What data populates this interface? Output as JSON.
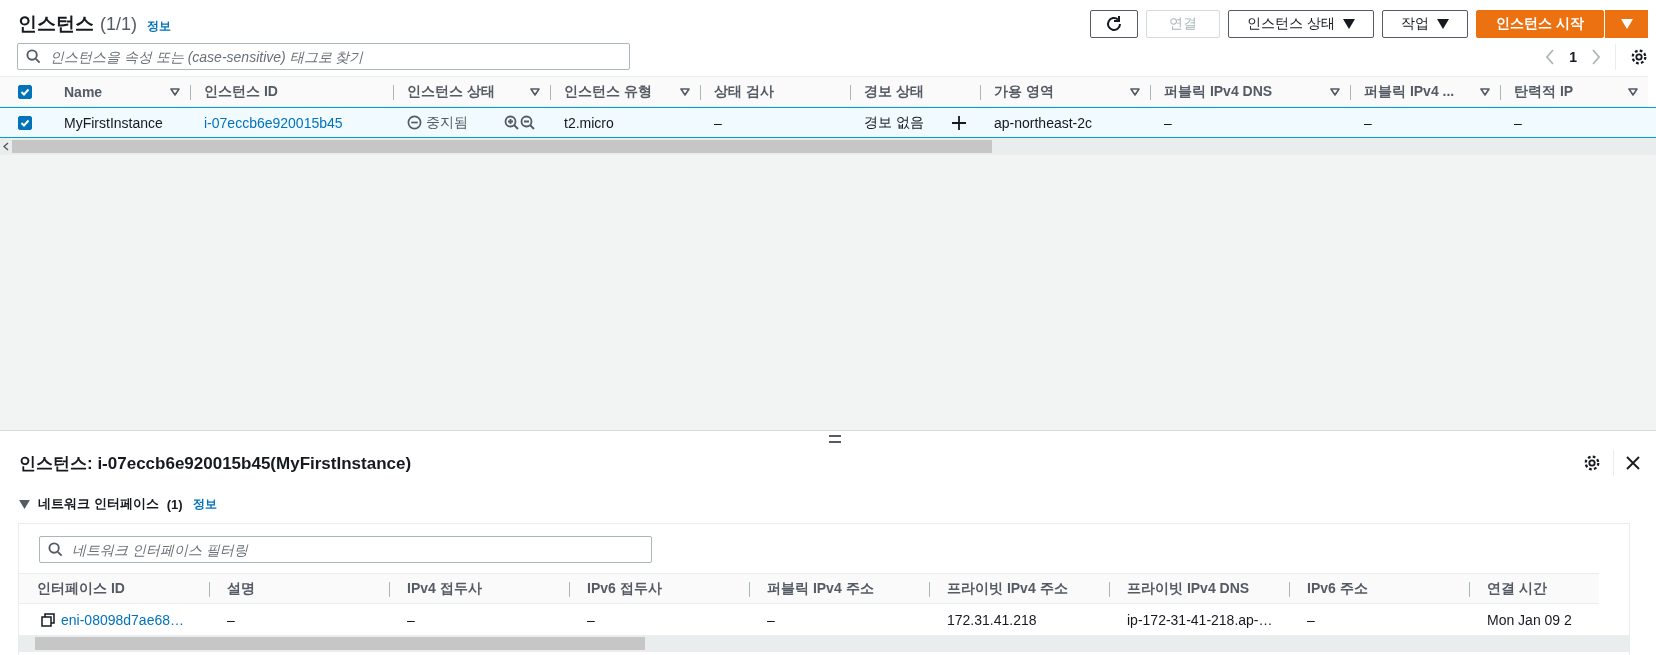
{
  "header": {
    "title": "인스턴스",
    "count": "(1/1)",
    "info_link": "정보"
  },
  "toolbar": [
    {
      "kind": "refresh",
      "disabled": false
    },
    {
      "kind": "text",
      "label": "연결",
      "disabled": true
    },
    {
      "kind": "dropdown",
      "label": "인스턴스 상태",
      "disabled": false
    },
    {
      "kind": "dropdown",
      "label": "작업",
      "disabled": false
    },
    {
      "kind": "primary-split",
      "label": "인스턴스 시작",
      "disabled": false
    }
  ],
  "search": {
    "placeholder": "인스턴스을 속성 또는 (case-sensitive) 태그로 찾기"
  },
  "pagination": {
    "page": "1"
  },
  "table": {
    "all_checked": true,
    "columns": [
      {
        "label": "Name",
        "filter": true
      },
      {
        "label": "인스턴스 ID",
        "filter": false
      },
      {
        "label": "인스턴스 상태",
        "filter": true
      },
      {
        "label": "인스턴스 유형",
        "filter": true
      },
      {
        "label": "상태 검사",
        "filter": false
      },
      {
        "label": "경보 상태",
        "filter": false
      },
      {
        "label": "가용 영역",
        "filter": true
      },
      {
        "label": "퍼블릭 IPv4 DNS",
        "filter": true
      },
      {
        "label": "퍼블릭 IPv4 ...",
        "filter": true
      },
      {
        "label": "탄력적 IP",
        "filter": true
      }
    ],
    "rows": [
      {
        "checked": true,
        "selected": true,
        "cells": [
          {
            "kind": "text",
            "text": "MyFirstInstance"
          },
          {
            "kind": "link",
            "text": "i-07eccb6e920015b45"
          },
          {
            "kind": "status",
            "text": "중지됨"
          },
          {
            "kind": "text",
            "text": "t2.micro"
          },
          {
            "kind": "text",
            "text": "–"
          },
          {
            "kind": "alarm",
            "text": "경보 없음"
          },
          {
            "kind": "text",
            "text": "ap-northeast-2c"
          },
          {
            "kind": "text",
            "text": "–"
          },
          {
            "kind": "text",
            "text": "–"
          },
          {
            "kind": "text",
            "text": "–"
          }
        ]
      }
    ]
  },
  "details": {
    "title": "인스턴스: i-07eccb6e920015b45(MyFirstInstance)",
    "section": {
      "title": "네트워크 인터페이스",
      "count": "(1)",
      "info_link": "정보",
      "expanded": true,
      "filter": {
        "placeholder": "네트워크 인터페이스 필터링"
      },
      "columns": [
        "인터페이스 ID",
        "설명",
        "IPv4 접두사",
        "IPv6 접두사",
        "퍼블릭 IPv4 주소",
        "프라이빗 IPv4 주소",
        "프라이빗 IPv4 DNS",
        "IPv6 주소",
        "연결 시간"
      ],
      "rows": [
        {
          "cells": [
            {
              "kind": "copy-link",
              "text": "eni-08098d7ae68…"
            },
            {
              "kind": "text",
              "text": "–"
            },
            {
              "kind": "text",
              "text": "–"
            },
            {
              "kind": "text",
              "text": "–"
            },
            {
              "kind": "text",
              "text": "–"
            },
            {
              "kind": "text",
              "text": "172.31.41.218"
            },
            {
              "kind": "text",
              "text": "ip-172-31-41-218.ap-…"
            },
            {
              "kind": "text",
              "text": "–"
            },
            {
              "kind": "text",
              "text": "Mon Jan 09 2"
            }
          ]
        }
      ]
    }
  }
}
